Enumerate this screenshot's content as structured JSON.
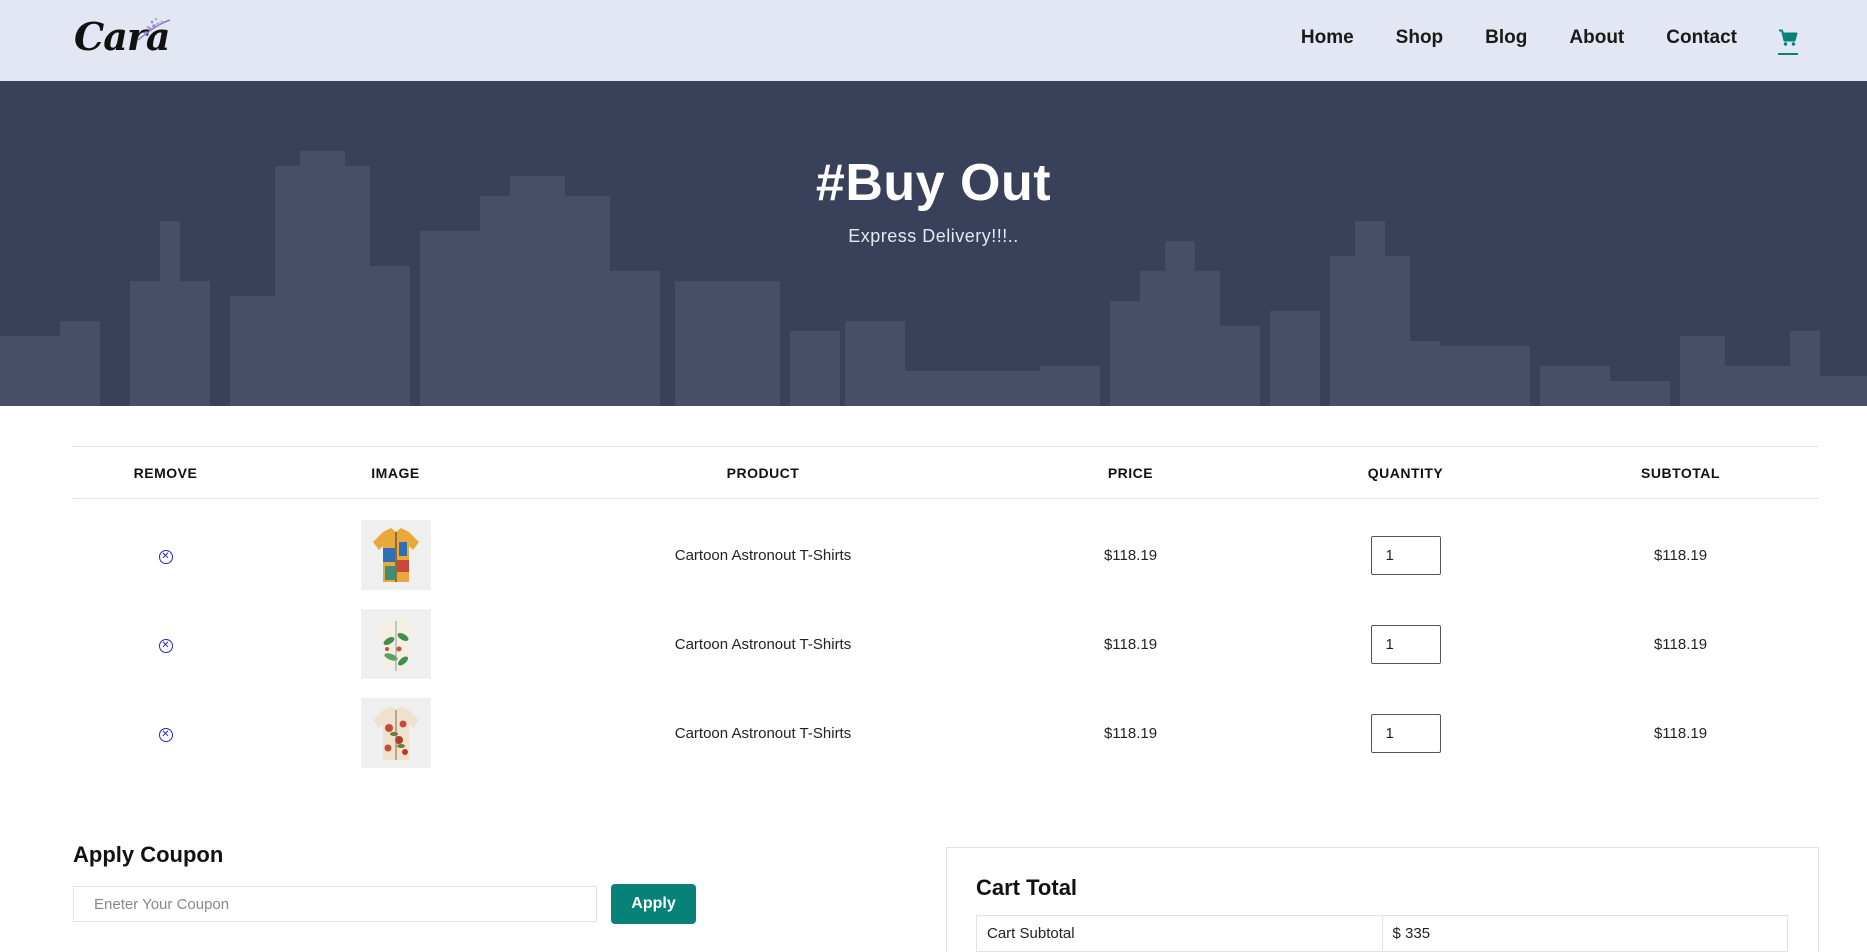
{
  "brand": {
    "logo_text": "Cara"
  },
  "nav": {
    "items": [
      {
        "label": "Home"
      },
      {
        "label": "Shop"
      },
      {
        "label": "Blog"
      },
      {
        "label": "About"
      },
      {
        "label": "Contact"
      }
    ],
    "cart_icon": "shopping-cart-icon",
    "accent": "#088178"
  },
  "hero": {
    "title": "#Buy Out",
    "subtitle": "Express Delivery!!!.."
  },
  "cart": {
    "headers": [
      "REMOVE",
      "IMAGE",
      "PRODUCT",
      "PRICE",
      "QUANTITY",
      "SUBTOTAL"
    ],
    "rows": [
      {
        "product": "Cartoon Astronout T-Shirts",
        "price": "$118.19",
        "quantity": "1",
        "subtotal": "$118.19",
        "image_icon": "shirt-multicolor-pattern"
      },
      {
        "product": "Cartoon Astronout T-Shirts",
        "price": "$118.19",
        "quantity": "1",
        "subtotal": "$118.19",
        "image_icon": "shirt-leaf-pattern"
      },
      {
        "product": "Cartoon Astronout T-Shirts",
        "price": "$118.19",
        "quantity": "1",
        "subtotal": "$118.19",
        "image_icon": "shirt-floral-pattern"
      }
    ],
    "remove_icon": "remove-circle-icon"
  },
  "coupon": {
    "title": "Apply Coupon",
    "placeholder": "Eneter Your Coupon",
    "button_label": "Apply",
    "button_color": "#088178"
  },
  "totals": {
    "title": "Cart Total",
    "rows": [
      {
        "label": "Cart Subtotal",
        "value": "$ 335"
      }
    ]
  }
}
